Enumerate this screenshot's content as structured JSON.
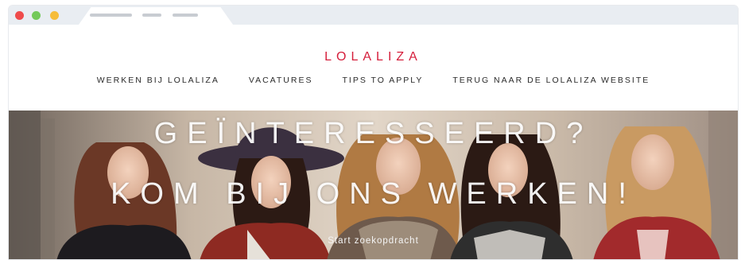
{
  "brand": {
    "logo_text": "LOLALIZA",
    "accent_color": "#d51e3b"
  },
  "nav": {
    "items": [
      {
        "label": "WERKEN BIJ LOLALIZA"
      },
      {
        "label": "VACATURES"
      },
      {
        "label": "TIPS TO APPLY"
      },
      {
        "label": "TERUG NAAR DE LOLALIZA WEBSITE"
      }
    ]
  },
  "hero": {
    "headline_line1": "GEÏNTERESSEERD?",
    "headline_line2": "KOM BIJ ONS WERKEN!",
    "cta_label": "Start zoekopdracht"
  }
}
